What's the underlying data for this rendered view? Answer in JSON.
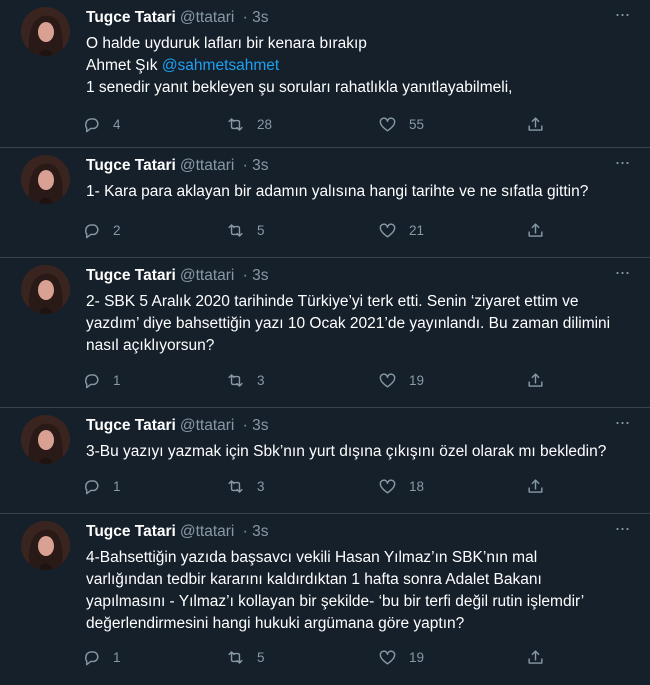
{
  "tweets": [
    {
      "name": "Tugce Tatari",
      "handle": "@ttatari",
      "time": "· 3s",
      "lines": [
        "O halde uyduruk lafları bir kenara bırakıp",
        "Ahmet Şık ",
        "1 senedir yanıt bekleyen şu soruları rahatlıkla yanıtlayabilmeli,"
      ],
      "mention": "@sahmetsahmet",
      "replies": "4",
      "retweets": "28",
      "likes": "55"
    },
    {
      "name": "Tugce Tatari",
      "handle": "@ttatari",
      "time": "· 3s",
      "lines": [
        "1- Kara para aklayan bir adamın yalısına hangi tarihte ve ne sıfatla gittin?"
      ],
      "replies": "2",
      "retweets": "5",
      "likes": "21"
    },
    {
      "name": "Tugce Tatari",
      "handle": "@ttatari",
      "time": "· 3s",
      "lines": [
        "2- SBK 5 Aralık 2020 tarihinde Türkiye’yi terk etti. Senin ‘ziyaret ettim ve",
        "yazdım’ diye bahsettiğin yazı 10 Ocak 2021’de  yayınlandı. Bu zaman dilimini",
        "nasıl açıklıyorsun?"
      ],
      "replies": "1",
      "retweets": "3",
      "likes": "19"
    },
    {
      "name": "Tugce Tatari",
      "handle": "@ttatari",
      "time": "· 3s",
      "lines": [
        "3-Bu yazıyı yazmak için Sbk’nın yurt dışına çıkışını özel olarak mı bekledin?"
      ],
      "replies": "1",
      "retweets": "3",
      "likes": "18"
    },
    {
      "name": "Tugce Tatari",
      "handle": "@ttatari",
      "time": "· 3s",
      "lines": [
        "4-Bahsettiğin yazıda başsavcı vekili Hasan Yılmaz’ın  SBK’nın mal",
        "varlığından tedbir kararını kaldırdıktan 1 hafta sonra Adalet Bakanı",
        "yapılmasını - Yılmaz’ı kollayan bir şekilde-  ‘bu bir terfi değil rutin işlemdir’",
        "değerlendirmesini hangi hukuki argümana göre yaptın?"
      ],
      "replies": "1",
      "retweets": "5",
      "likes": "19"
    }
  ]
}
